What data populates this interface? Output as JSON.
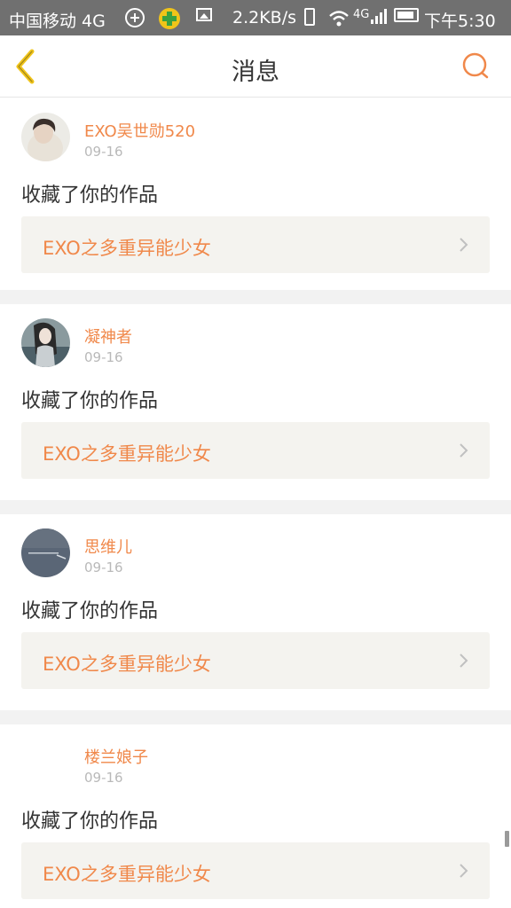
{
  "status_bar": {
    "carrier": "中国移动 4G",
    "speed": "2.2KB/s",
    "network": "4G",
    "time": "下午5:30"
  },
  "header": {
    "title": "消息",
    "back_icon": "chevron-left-icon",
    "search_icon": "search-icon"
  },
  "colors": {
    "accent": "#f0884a",
    "back_icon": "#f0c419",
    "card_bg": "#f4f3ef"
  },
  "messages": [
    {
      "name": "EXO吴世勋520",
      "date": "09-16",
      "action": "收藏了你的作品",
      "work_title": "EXO之多重异能少女"
    },
    {
      "name": "凝神者",
      "date": "09-16",
      "action": "收藏了你的作品",
      "work_title": "EXO之多重异能少女"
    },
    {
      "name": "思维儿",
      "date": "09-16",
      "action": "收藏了你的作品",
      "work_title": "EXO之多重异能少女"
    },
    {
      "name": "楼兰娘子",
      "date": "09-16",
      "action": "收藏了你的作品",
      "work_title": "EXO之多重异能少女"
    }
  ]
}
